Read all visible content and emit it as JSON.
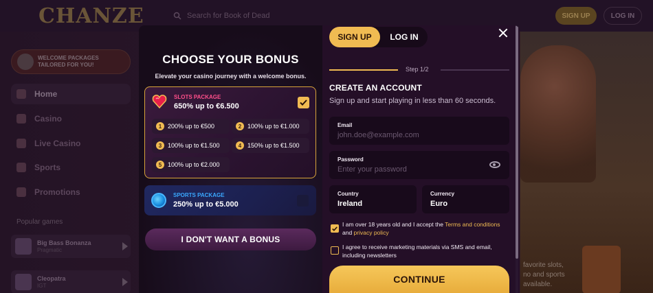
{
  "background": {
    "logo": "CHANZE",
    "search_placeholder": "Search for Book of Dead",
    "header_signup": "SIGN UP",
    "header_login": "LOG IN",
    "welcome_line1": "WELCOME PACKAGES",
    "welcome_line2": "TAILORED FOR YOU!",
    "nav": [
      "Home",
      "Casino",
      "Live Casino",
      "Sports",
      "Promotions"
    ],
    "popular_title": "Popular games",
    "popular": [
      {
        "name": "Big Bass Bonanza",
        "provider": "Pragmatic"
      },
      {
        "name": "Cleopatra",
        "provider": "IGT"
      }
    ],
    "right_text_1": "favorite slots,",
    "right_text_2": "no and sports",
    "right_text_3": "available."
  },
  "bonus": {
    "title": "CHOOSE YOUR BONUS",
    "subtitle": "Elevate your casino journey with a welcome bonus.",
    "slots_label": "SLOTS PACKAGE",
    "slots_value": "650% up to €6.500",
    "slots_checked": true,
    "options": [
      {
        "n": "1",
        "text": "200% up to €500"
      },
      {
        "n": "2",
        "text": "100% up to €1.000"
      },
      {
        "n": "3",
        "text": "100% up to €1.500"
      },
      {
        "n": "4",
        "text": "150% up to €1.500"
      },
      {
        "n": "5",
        "text": "100% up to €2.000"
      }
    ],
    "sports_label": "SPORTS PACKAGE",
    "sports_value": "250% up to €5.000",
    "sports_checked": false,
    "no_bonus": "I DON'T WANT A BONUS"
  },
  "form": {
    "tab_signup": "SIGN UP",
    "tab_login": "LOG IN",
    "step": "Step 1/2",
    "progress_fraction": 0.5,
    "title": "CREATE AN ACCOUNT",
    "subtitle": "Sign up and start playing in less than 60 seconds.",
    "email_label": "Email",
    "email_placeholder": "john.doe@example.com",
    "password_label": "Password",
    "password_placeholder": "Enter your password",
    "country_label": "Country",
    "country_value": "Ireland",
    "currency_label": "Currency",
    "currency_value": "Euro",
    "age_text_1": "I am over 18 years old and I accept the ",
    "age_link_terms": "Terms and conditions",
    "age_text_2": "and ",
    "age_link_privacy": "privacy policy",
    "age_checked": true,
    "marketing_text": "I agree to receive marketing materials via SMS and email, including newsletters",
    "marketing_checked": false,
    "continue": "CONTINUE"
  },
  "colors": {
    "accent": "#f0bb52",
    "slots_label": "#ff4f8a",
    "sports_label": "#3aa8ff",
    "modal_bg": "#240f27"
  }
}
